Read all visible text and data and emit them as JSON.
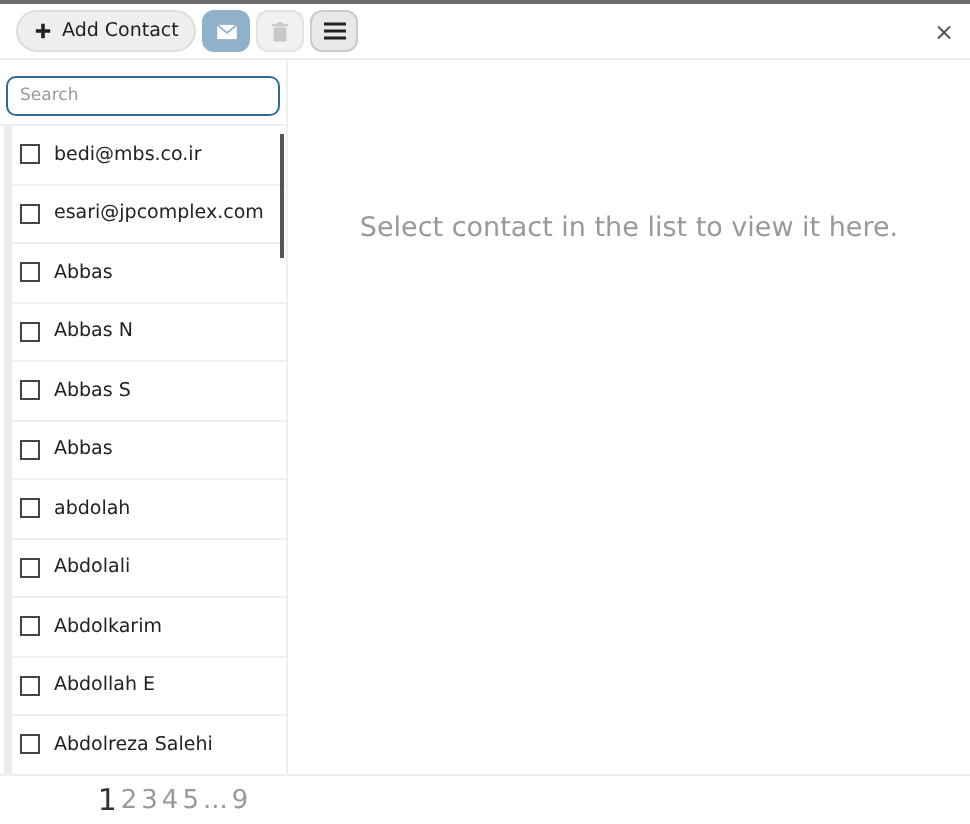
{
  "toolbar": [
    {
      "kind": "add",
      "label": "Add Contact",
      "disabled": false
    },
    {
      "kind": "email",
      "disabled": false
    },
    {
      "kind": "delete",
      "disabled": true
    },
    {
      "kind": "menu",
      "disabled": false
    }
  ],
  "close": "×",
  "search": {
    "placeholder": "Search"
  },
  "contacts": [
    {
      "name": "bedi@mbs.co.ir",
      "checked": false
    },
    {
      "name": "esari@jpcomplex.com",
      "checked": false
    },
    {
      "name": "Abbas",
      "checked": false
    },
    {
      "name": "Abbas N",
      "checked": false
    },
    {
      "name": "Abbas S",
      "checked": false
    },
    {
      "name": "Abbas",
      "checked": false
    },
    {
      "name": "abdolah",
      "checked": false
    },
    {
      "name": "Abdolali",
      "checked": false
    },
    {
      "name": "Abdolkarim",
      "checked": false
    },
    {
      "name": "Abdollah E",
      "checked": false
    },
    {
      "name": "Abdolreza Salehi",
      "checked": false
    }
  ],
  "pages": [
    {
      "label": "1",
      "selected": true
    },
    {
      "label": "2",
      "selected": false
    },
    {
      "label": "3",
      "selected": false
    },
    {
      "label": "4",
      "selected": false
    },
    {
      "label": "5",
      "selected": false
    },
    {
      "label": "...",
      "selected": false
    },
    {
      "label": "9",
      "selected": false
    }
  ],
  "empty_message": "Select contact in the list to view it here."
}
